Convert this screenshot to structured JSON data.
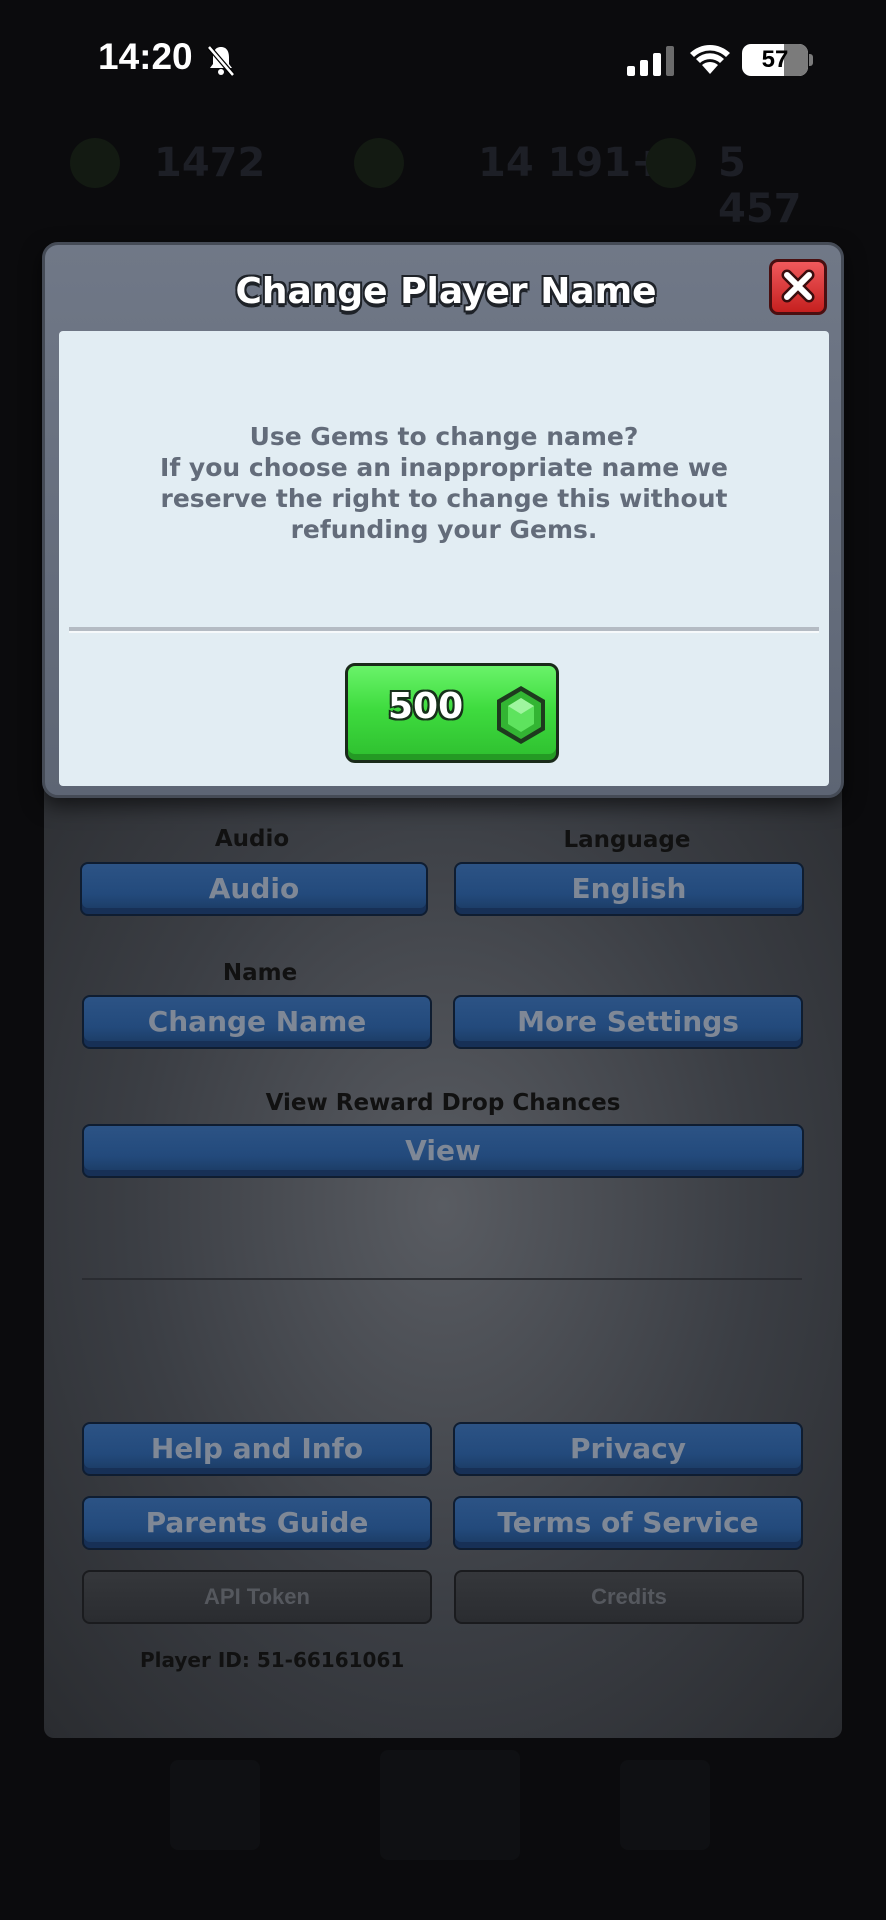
{
  "status_bar": {
    "time": "14:20",
    "battery": "57",
    "icons": [
      "bell-muted-icon",
      "signal-icon",
      "wifi-icon",
      "battery-icon"
    ]
  },
  "background_hud": {
    "trophies": "1472",
    "gold": "14 191+",
    "gems": "5 457"
  },
  "modal": {
    "title": "Change Player Name",
    "message_line1": "Use Gems to change name?",
    "message_line2": "If you choose an inappropriate name we",
    "message_line3": "reserve the right to change this without",
    "message_line4": "refunding your Gems.",
    "gem_button_amount": "500",
    "icons": [
      "close-icon",
      "gem-icon"
    ]
  },
  "settings": {
    "audio_label": "Audio",
    "audio_button": "Audio",
    "language_label": "Language",
    "language_button": "English",
    "name_label": "Name",
    "change_name_button": "Change Name",
    "more_settings_button": "More Settings",
    "drop_chances_label": "View Reward Drop Chances",
    "view_button": "View",
    "help_button": "Help and Info",
    "privacy_button": "Privacy",
    "parents_button": "Parents Guide",
    "tos_button": "Terms of Service",
    "api_button": "API Token",
    "credits_button": "Credits",
    "player_id": "Player ID: 51-66161061"
  },
  "colors": {
    "modal_frame": "#6a7280",
    "modal_body": "#e2edf3",
    "gem_button": "#3fdc3f",
    "close_button": "#d8312f",
    "settings_button": "#264c7e"
  }
}
